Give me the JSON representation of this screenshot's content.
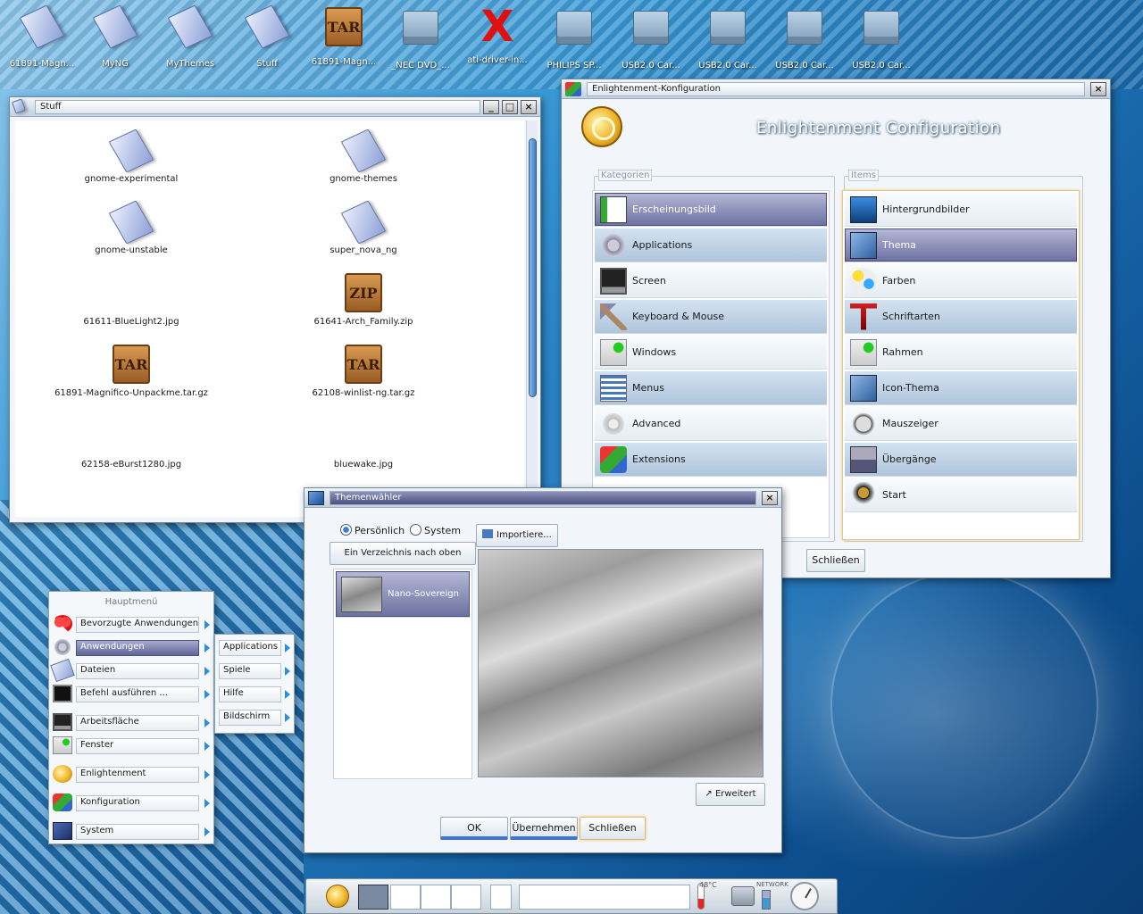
{
  "desktop": {
    "icons": [
      {
        "label": "61891-Magn...",
        "type": "document"
      },
      {
        "label": "MyNG",
        "type": "document"
      },
      {
        "label": "MyThemes",
        "type": "document"
      },
      {
        "label": "Stuff",
        "type": "document"
      },
      {
        "label": "61891-Magn...",
        "type": "tar"
      },
      {
        "label": "_NEC DVD_...",
        "type": "drive"
      },
      {
        "label": "ati-driver-in...",
        "type": "x-package"
      },
      {
        "label": "PHILIPS SP...",
        "type": "drive"
      },
      {
        "label": "USB2.0 Car...",
        "type": "drive"
      },
      {
        "label": "USB2.0 Car...",
        "type": "drive"
      },
      {
        "label": "USB2.0 Car...",
        "type": "drive"
      },
      {
        "label": "USB2.0 Car...",
        "type": "drive"
      }
    ]
  },
  "stuff_window": {
    "title": "Stuff",
    "buttons": {
      "minimize": "_",
      "maximize": "□",
      "close": "×"
    },
    "files": [
      {
        "name": "gnome-experimental",
        "icon": "document"
      },
      {
        "name": "gnome-themes",
        "icon": "document"
      },
      {
        "name": "gnome-unstable",
        "icon": "document"
      },
      {
        "name": "super_nova_ng",
        "icon": "document"
      },
      {
        "name": "61611-BlueLight2.jpg",
        "icon": "image"
      },
      {
        "name": "61641-Arch_Family.zip",
        "icon": "zip",
        "badge": "ZIP"
      },
      {
        "name": "61891-Magnifico-Unpackme.tar.gz",
        "icon": "tar",
        "badge": "TAR"
      },
      {
        "name": "62108-winlist-ng.tar.gz",
        "icon": "tar",
        "badge": "TAR"
      },
      {
        "name": "62158-eBurst1280.jpg",
        "icon": "image"
      },
      {
        "name": "bluewake.jpg",
        "icon": "image"
      }
    ]
  },
  "config_window": {
    "title": "Enlightenment-Konfiguration",
    "heading": "Enlightenment Configuration",
    "categories_legend": "Kategorien",
    "items_legend": "Items",
    "categories": [
      {
        "label": "Erscheinungsbild",
        "icon": "appearance-icon",
        "selected": true
      },
      {
        "label": "Applications",
        "icon": "gears-icon"
      },
      {
        "label": "Screen",
        "icon": "monitor-icon"
      },
      {
        "label": "Keyboard & Mouse",
        "icon": "hammer-icon"
      },
      {
        "label": "Windows",
        "icon": "window-add-icon"
      },
      {
        "label": "Menus",
        "icon": "menu-icon"
      },
      {
        "label": "Advanced",
        "icon": "gear-icon"
      },
      {
        "label": "Extensions",
        "icon": "blocks-icon"
      }
    ],
    "items": [
      {
        "label": "Hintergrundbilder",
        "icon": "wallpaper-icon"
      },
      {
        "label": "Thema",
        "icon": "theme-icon",
        "selected": true
      },
      {
        "label": "Farben",
        "icon": "palette-icon"
      },
      {
        "label": "Schriftarten",
        "icon": "font-icon"
      },
      {
        "label": "Rahmen",
        "icon": "border-icon"
      },
      {
        "label": "Icon-Thema",
        "icon": "icon-theme-icon"
      },
      {
        "label": "Mauszeiger",
        "icon": "mouse-icon"
      },
      {
        "label": "Übergänge",
        "icon": "transition-icon"
      },
      {
        "label": "Start",
        "icon": "startup-icon"
      }
    ],
    "close_button": "Schließen"
  },
  "theme_window": {
    "title": "Themenwähler",
    "radio_personal": "Persönlich",
    "radio_system": "System",
    "import_button": "Importiere...",
    "up_button": "Ein Verzeichnis nach oben",
    "themes": [
      {
        "label": "Nano-Sovereign",
        "selected": true
      }
    ],
    "advanced_button": "Erweitert",
    "ok_button": "OK",
    "apply_button": "Übernehmen",
    "close_button": "Schließen"
  },
  "main_menu": {
    "title": "Hauptmenü",
    "items": [
      {
        "label": "Bevorzugte Anwendungen",
        "icon": "heart-icon"
      },
      {
        "label": "Anwendungen",
        "icon": "gears-icon",
        "selected": true
      },
      {
        "label": "Dateien",
        "icon": "document-icon"
      },
      {
        "label": "Befehl ausführen ...",
        "icon": "terminal-icon"
      },
      {
        "label": "Arbeitsfläche",
        "icon": "monitor-icon"
      },
      {
        "label": "Fenster",
        "icon": "window-add-icon"
      },
      {
        "label": "Enlightenment",
        "icon": "e-logo-icon"
      },
      {
        "label": "Konfiguration",
        "icon": "blocks-icon"
      },
      {
        "label": "System",
        "icon": "system-icon"
      }
    ],
    "submenu": [
      {
        "label": "Applications"
      },
      {
        "label": "Spiele"
      },
      {
        "label": "Hilfe"
      },
      {
        "label": "Bildschirm"
      }
    ]
  },
  "shelf": {
    "temperature": "48°C",
    "battery": "NETWORK"
  }
}
